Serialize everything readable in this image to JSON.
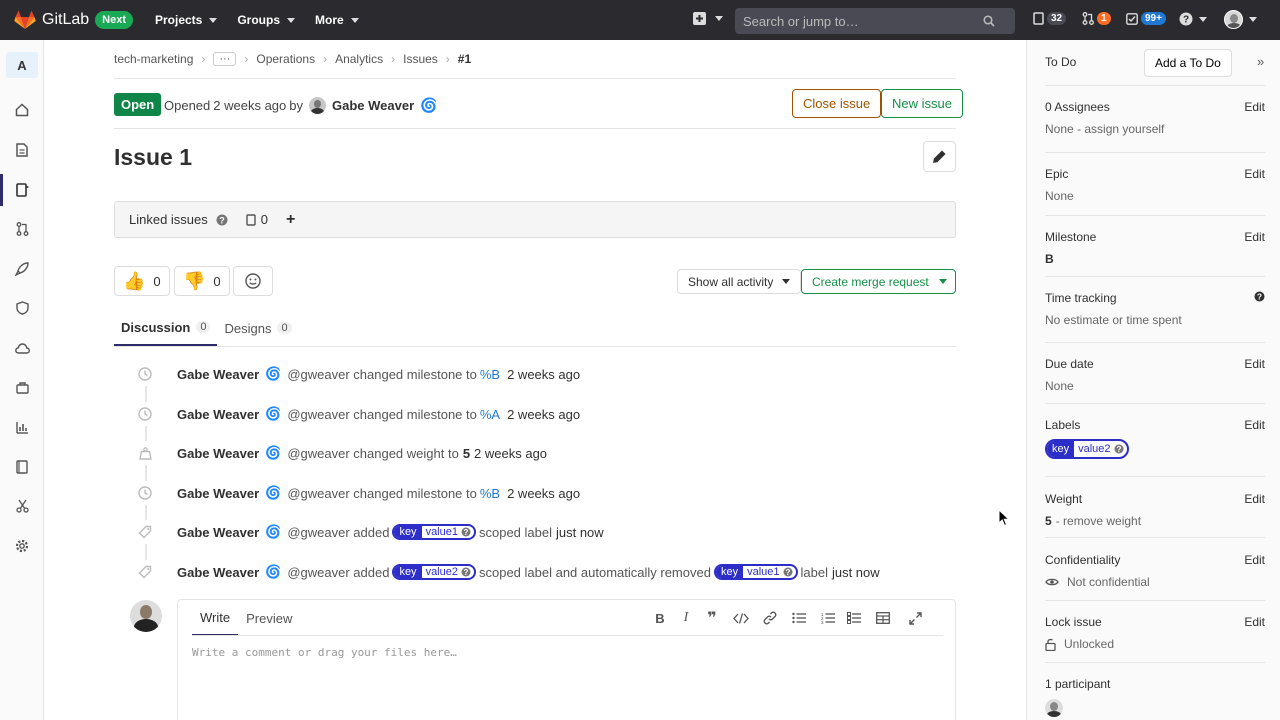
{
  "topbar": {
    "brand": "GitLab",
    "next_badge": "Next",
    "menus": [
      "Projects",
      "Groups",
      "More"
    ],
    "search_placeholder": "Search or jump to…",
    "issues_count": "32",
    "mr_count": "1",
    "todos_count": "99+"
  },
  "sidebar": {
    "project_letter": "A",
    "icons": [
      "home-icon",
      "repository-icon",
      "issues-icon",
      "merge-requests-icon",
      "rocket-icon",
      "shield-icon",
      "cloud-icon",
      "package-icon",
      "analytics-icon",
      "wiki-icon",
      "snippets-icon",
      "settings-icon"
    ]
  },
  "breadcrumb": [
    "tech-marketing",
    "···",
    "Operations",
    "Analytics",
    "Issues",
    "#1"
  ],
  "issue": {
    "status": "Open",
    "opened_prefix": "Opened",
    "opened_time": "2 weeks ago",
    "by": "by",
    "author": "Gabe Weaver",
    "close_label": "Close issue",
    "new_label": "New issue",
    "title": "Issue 1"
  },
  "linked": {
    "label": "Linked issues",
    "count": "0",
    "add": "+"
  },
  "awards": {
    "thumbsup": "👍",
    "thumbsup_count": "0",
    "thumbsdown": "👎",
    "thumbsdown_count": "0"
  },
  "actions": {
    "activity": "Show all activity",
    "create_mr": "Create merge request"
  },
  "tabs": [
    {
      "label": "Discussion",
      "count": "0"
    },
    {
      "label": "Designs",
      "count": "0"
    }
  ],
  "notes": [
    {
      "icon": "clock-icon",
      "name": "Gabe Weaver",
      "text": "@gweaver changed milestone to",
      "ref": "%B",
      "time": "2 weeks ago"
    },
    {
      "icon": "clock-icon",
      "name": "Gabe Weaver",
      "text": "@gweaver changed milestone to",
      "ref": "%A",
      "time": "2 weeks ago"
    },
    {
      "icon": "weight-icon",
      "name": "Gabe Weaver",
      "text": "@gweaver changed weight to",
      "ref": "5",
      "time": "2 weeks ago"
    },
    {
      "icon": "clock-icon",
      "name": "Gabe Weaver",
      "text": "@gweaver changed milestone to",
      "ref": "%B",
      "time": "2 weeks ago"
    }
  ],
  "label_notes": [
    {
      "name": "Gabe Weaver",
      "added": "@gweaver added",
      "key": "key",
      "value": "value1",
      "suffix": "scoped label",
      "time": "just now"
    },
    {
      "name": "Gabe Weaver",
      "added": "@gweaver added",
      "key": "key",
      "value": "value2",
      "middle": "scoped label and automatically removed",
      "key2": "key",
      "value2": "value1",
      "suffix": "label",
      "time": "just now"
    }
  ],
  "editor": {
    "write": "Write",
    "preview": "Preview",
    "placeholder": "Write a comment or drag your files here…"
  },
  "right": {
    "todo": "To Do",
    "add_todo": "Add a To Do",
    "edit": "Edit",
    "assignees": {
      "title": "0 Assignees",
      "value": "None - assign yourself"
    },
    "epic": {
      "title": "Epic",
      "value": "None"
    },
    "milestone": {
      "title": "Milestone",
      "value": "B"
    },
    "time_tracking": {
      "title": "Time tracking",
      "value": "No estimate or time spent"
    },
    "due_date": {
      "title": "Due date",
      "value": "None"
    },
    "labels": {
      "title": "Labels",
      "key": "key",
      "value": "value2"
    },
    "weight": {
      "title": "Weight",
      "value": "5",
      "remove": "- remove weight"
    },
    "confidentiality": {
      "title": "Confidentiality",
      "value": "Not confidential"
    },
    "lock": {
      "title": "Lock issue",
      "value": "Unlocked"
    },
    "participants": {
      "title": "1 participant"
    }
  }
}
